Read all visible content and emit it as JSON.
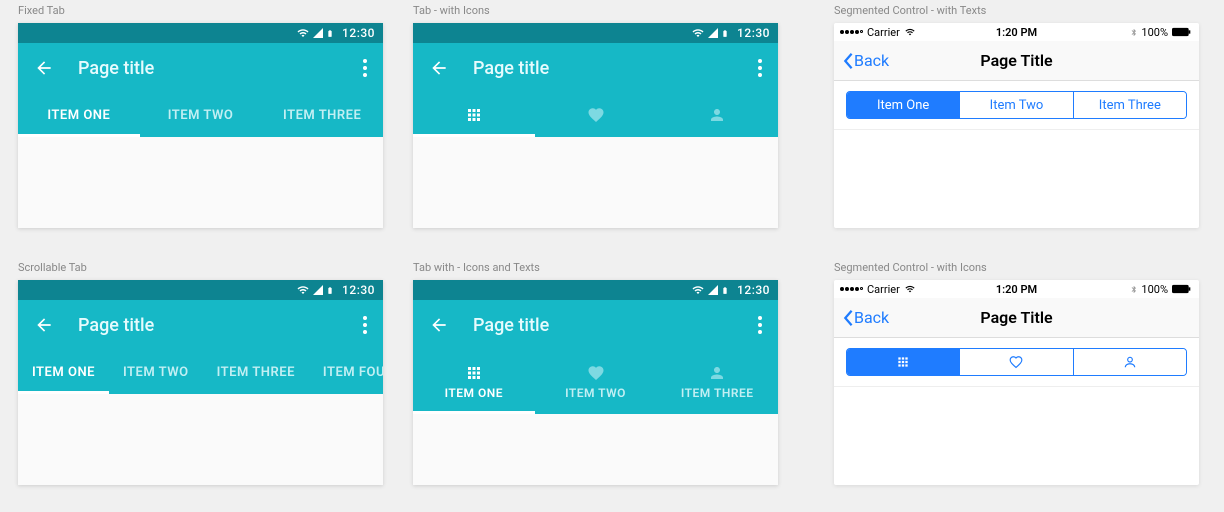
{
  "labels": {
    "fixed_tab": "Fixed Tab",
    "scrollable_tab": "Scrollable Tab",
    "tab_with_icons": "Tab - with Icons",
    "tab_with_icons_texts": "Tab with - Icons and Texts",
    "seg_texts": "Segmented Control - with Texts",
    "seg_icons": "Segmented Control - with Icons"
  },
  "android": {
    "status_time": "12:30",
    "page_title": "Page title",
    "tabs": {
      "item1": "ITEM ONE",
      "item2": "ITEM TWO",
      "item3": "ITEM THREE",
      "item4": "ITEM FOUR"
    }
  },
  "ios": {
    "carrier": "Carrier",
    "time": "1:20 PM",
    "battery": "100%",
    "back": "Back",
    "page_title": "Page Title",
    "seg": {
      "item1": "Item One",
      "item2": "Item Two",
      "item3": "Item Three"
    }
  }
}
